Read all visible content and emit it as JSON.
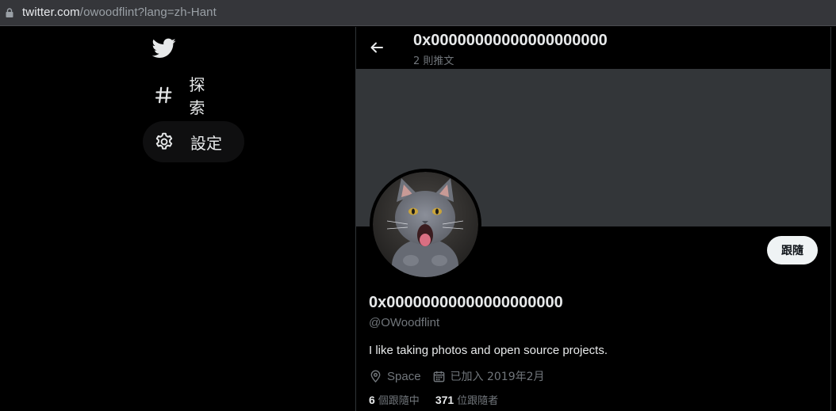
{
  "browser": {
    "url_host": "twitter.com",
    "url_path": "/owoodflint?lang=zh-Hant"
  },
  "sidebar": {
    "logo_icon": "twitter-bird-icon",
    "items": [
      {
        "label": "探索",
        "icon": "hashtag-icon"
      },
      {
        "label": "設定",
        "icon": "gear-icon"
      }
    ]
  },
  "header": {
    "title": "0x00000000000000000000",
    "post_count": "2 則推文"
  },
  "profile": {
    "banner_color": "#333639",
    "avatar": "gray-kitten-photo",
    "follow_label": "跟隨",
    "display_name": "0x00000000000000000000",
    "handle": "@OWoodflint",
    "bio": "I like taking photos and open source projects.",
    "location": "Space",
    "joined": "已加入 2019年2月",
    "following_count": "6",
    "following_label": "個跟隨中",
    "followers_count": "371",
    "followers_label": "位跟隨者"
  }
}
